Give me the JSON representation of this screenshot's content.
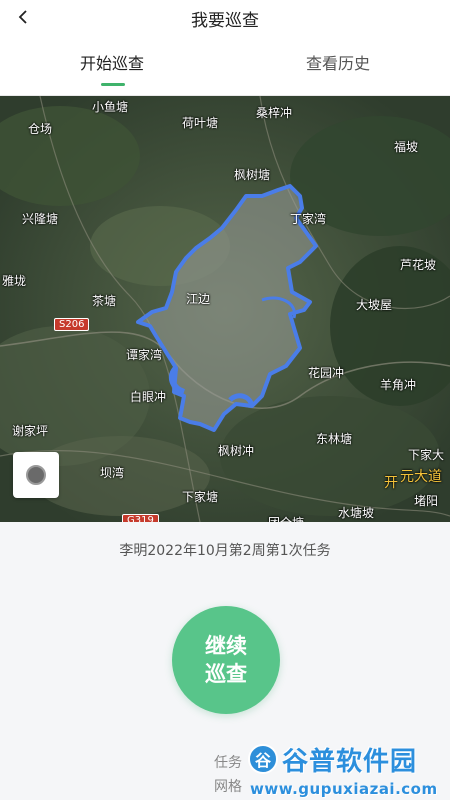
{
  "header": {
    "title": "我要巡查",
    "back_icon": "chevron-left-icon"
  },
  "tabs": [
    {
      "label": "开始巡查",
      "active": true
    },
    {
      "label": "查看历史",
      "active": false
    }
  ],
  "map": {
    "places": [
      "小鱼塘",
      "荷叶塘",
      "桑梓冲",
      "仓场",
      "福坡",
      "枫树塘",
      "兴隆塘",
      "丁家湾",
      "芦花坡",
      "雅垅",
      "茶塘",
      "江边",
      "大坡屋",
      "谭家湾",
      "花园冲",
      "羊角冲",
      "白眼冲",
      "谢家坪",
      "东林塘",
      "枫树冲",
      "下家大",
      "坝湾",
      "下家塘",
      "水塘坡",
      "团全塘",
      "开",
      "元大道",
      "堵阳"
    ],
    "roads": [
      "S206",
      "G319"
    ],
    "locate_icon": "locate-icon",
    "boundary_color": "#4a7de8"
  },
  "task": {
    "text": "李明2022年10月第2周第1次任务"
  },
  "continue_button": {
    "label_line1": "继续",
    "label_line2": "巡查"
  },
  "info": {
    "line1": "任务",
    "line2": "网格"
  },
  "watermark": {
    "logo": "谷",
    "name": "谷普软件园",
    "url": "www.gupuxiazai.com"
  },
  "colors": {
    "accent": "#3fb36b",
    "button": "#58c58a"
  }
}
